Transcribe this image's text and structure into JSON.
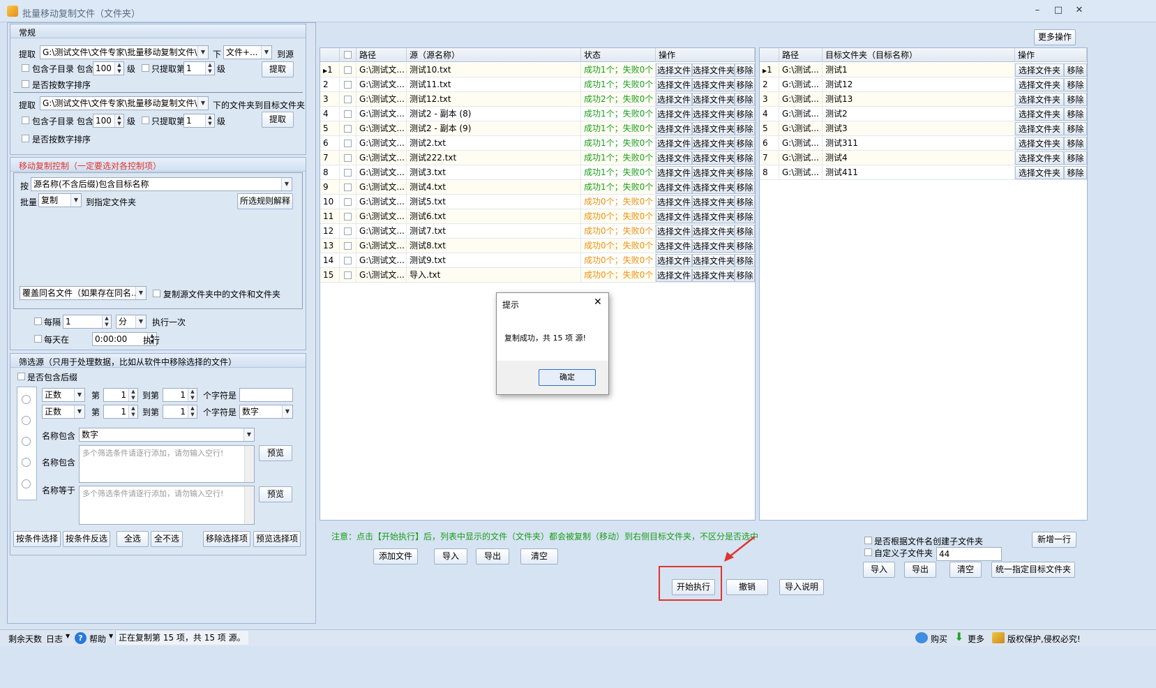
{
  "window": {
    "title": "批量移动复制文件（文件夹）",
    "min": "–",
    "max": "□",
    "close": "✕"
  },
  "left": {
    "general": {
      "title": "常规",
      "row1": {
        "label": "提取",
        "path": "G:\\测试文件\\文件专家\\批量移动复制文件\\技",
        "under": "下",
        "type": "文件+...",
        "to": "到源"
      },
      "row1opts": {
        "subdir": "包含子目录",
        "contain": "包含",
        "levels": "100",
        "level_unit": "级",
        "only": "只提取第",
        "only_val": "1",
        "only_unit": "级",
        "btn": "提取"
      },
      "row1sort": "是否按数字排序",
      "row2": {
        "label": "提取",
        "path": "G:\\测试文件\\文件专家\\批量移动复制文件\\技",
        "tail": "下的文件夹到目标文件夹"
      },
      "row2opts": {
        "subdir": "包含子目录",
        "contain": "包含",
        "levels": "100",
        "level_unit": "级",
        "only": "只提取第",
        "only_val": "1",
        "only_unit": "级",
        "btn": "提取"
      },
      "row2sort": "是否按数字排序"
    },
    "control": {
      "title": "移动复制控制（一定要选对各控制项）",
      "by_label": "按",
      "by_value": "源名称(不含后缀)包含目标名称",
      "batch_label": "批量",
      "batch_value": "复制",
      "to_folder": "到指定文件夹",
      "explain_btn": "所选规则解释",
      "overwrite": "覆盖同名文件（如果存在同名...",
      "copy_contents": "复制源文件夹中的文件和文件夹",
      "every_label": "每隔",
      "every_val": "1",
      "every_unit": "分",
      "every_tail": "执行一次",
      "daily_label": "每天在",
      "daily_val": "0:00:00",
      "daily_tail": "执行"
    },
    "filter": {
      "title": "筛选源（只用于处理数据，比如从软件中移除选择的文件）",
      "has_suffix": "是否包含后缀",
      "r1": {
        "mode": "正数",
        "nth": "第",
        "a": "1",
        "to": "到第",
        "b": "1",
        "chars": "个字符是",
        "val": ""
      },
      "r2": {
        "mode": "正数",
        "nth": "第",
        "a": "1",
        "to": "到第",
        "b": "1",
        "chars": "个字符是",
        "val": "数字"
      },
      "name_contains_label": "名称包含",
      "name_contains_value": "数字",
      "name_contains2_label": "名称包含",
      "name_equals_label": "名称等于",
      "placeholder": "多个筛选条件请逐行添加，请勿输入空行!",
      "preview": "预览",
      "btns": [
        "按条件选择",
        "按条件反选",
        "全选",
        "全不选",
        "移除选择项",
        "预览选择项"
      ]
    }
  },
  "more_ops": "更多操作",
  "source_grid": {
    "headers": [
      "",
      "路径",
      "源（源名称）",
      "状态",
      "操作"
    ],
    "rows": [
      {
        "n": "1",
        "path": "G:\\测试文...",
        "name": "测试10.txt",
        "status": "成功1个；失败0个",
        "ok": true
      },
      {
        "n": "2",
        "path": "G:\\测试文...",
        "name": "测试11.txt",
        "status": "成功1个；失败0个",
        "ok": true
      },
      {
        "n": "3",
        "path": "G:\\测试文...",
        "name": "测试12.txt",
        "status": "成功2个；失败0个",
        "ok": true
      },
      {
        "n": "4",
        "path": "G:\\测试文...",
        "name": "测试2 - 副本 (8)",
        "status": "成功1个；失败0个",
        "ok": true
      },
      {
        "n": "5",
        "path": "G:\\测试文...",
        "name": "测试2 - 副本 (9)",
        "status": "成功1个；失败0个",
        "ok": true
      },
      {
        "n": "6",
        "path": "G:\\测试文...",
        "name": "测试2.txt",
        "status": "成功1个；失败0个",
        "ok": true
      },
      {
        "n": "7",
        "path": "G:\\测试文...",
        "name": "测试222.txt",
        "status": "成功1个；失败0个",
        "ok": true
      },
      {
        "n": "8",
        "path": "G:\\测试文...",
        "name": "测试3.txt",
        "status": "成功1个；失败0个",
        "ok": true
      },
      {
        "n": "9",
        "path": "G:\\测试文...",
        "name": "测试4.txt",
        "status": "成功1个；失败0个",
        "ok": true
      },
      {
        "n": "10",
        "path": "G:\\测试文...",
        "name": "测试5.txt",
        "status": "成功0个；失败0个",
        "ok": false
      },
      {
        "n": "11",
        "path": "G:\\测试文...",
        "name": "测试6.txt",
        "status": "成功0个；失败0个",
        "ok": false
      },
      {
        "n": "12",
        "path": "G:\\测试文...",
        "name": "测试7.txt",
        "status": "成功0个；失败0个",
        "ok": false
      },
      {
        "n": "13",
        "path": "G:\\测试文...",
        "name": "测试8.txt",
        "status": "成功0个；失败0个",
        "ok": false
      },
      {
        "n": "14",
        "path": "G:\\测试文...",
        "name": "测试9.txt",
        "status": "成功0个；失败0个",
        "ok": false
      },
      {
        "n": "15",
        "path": "G:\\测试文...",
        "name": "导入.txt",
        "status": "成功0个；失败0个",
        "ok": false
      }
    ],
    "op_labels": [
      "选择文件",
      "选择文件夹",
      "移除"
    ]
  },
  "target_grid": {
    "headers": [
      "",
      "路径",
      "目标文件夹（目标名称）",
      "操作"
    ],
    "rows": [
      {
        "n": "1",
        "path": "G:\\测试...",
        "name": "测试1"
      },
      {
        "n": "2",
        "path": "G:\\测试...",
        "name": "测试12"
      },
      {
        "n": "3",
        "path": "G:\\测试...",
        "name": "测试13"
      },
      {
        "n": "4",
        "path": "G:\\测试...",
        "name": "测试2"
      },
      {
        "n": "5",
        "path": "G:\\测试...",
        "name": "测试3"
      },
      {
        "n": "6",
        "path": "G:\\测试...",
        "name": "测试311"
      },
      {
        "n": "7",
        "path": "G:\\测试...",
        "name": "测试4"
      },
      {
        "n": "8",
        "path": "G:\\测试...",
        "name": "测试411"
      }
    ],
    "op_labels": [
      "选择文件夹",
      "移除"
    ]
  },
  "notice": "注意：点击【开始执行】后，列表中显示的文件（文件夹）都会被复制（移动）到右侧目标文件夹，不区分是否选中",
  "source_btns": {
    "add": "添加文件",
    "import": "导入",
    "export": "导出",
    "clear": "清空"
  },
  "target_opts": {
    "by_name": "是否根据文件名创建子文件夹",
    "custom": "自定义子文件夹",
    "custom_val": "44",
    "new_row": "新增一行"
  },
  "target_btns": {
    "import": "导入",
    "export": "导出",
    "clear": "清空",
    "unify": "统一指定目标文件夹"
  },
  "exec_btns": {
    "start": "开始执行",
    "cancel": "撤销",
    "help": "导入说明"
  },
  "dialog": {
    "title": "提示",
    "message": "复制成功，共 15 项 源!",
    "ok": "确定"
  },
  "status": {
    "days": "剩余天数",
    "log": "日志",
    "help": "帮助",
    "message": "正在复制第 15 项，共 15 项 源。",
    "buy": "购买",
    "more": "更多",
    "copyright": "版权保护,侵权必究!"
  },
  "colors": {
    "accent_red": "#e0342f",
    "success": "#1a9d1a",
    "warning": "#f0900f"
  }
}
